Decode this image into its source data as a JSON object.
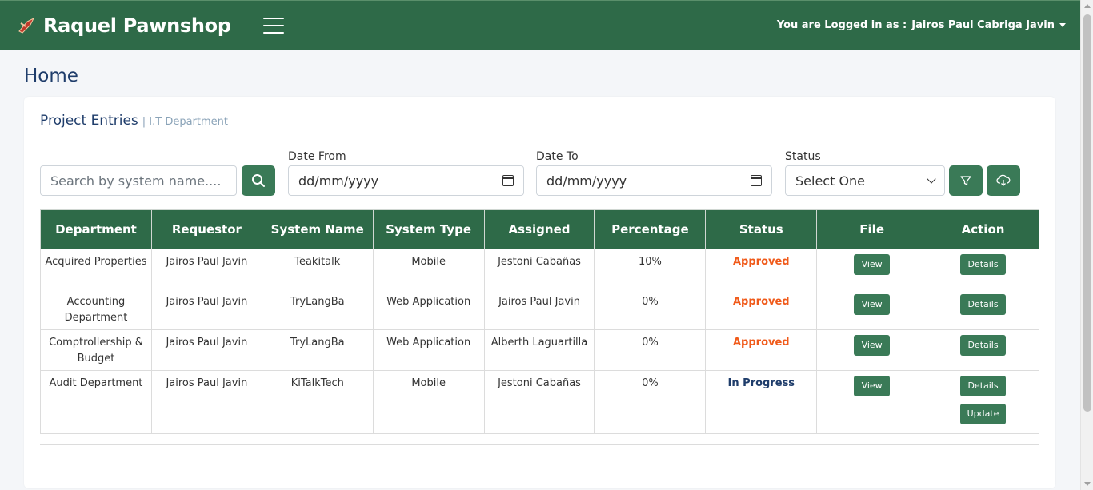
{
  "app": {
    "brand_name": "Raquel Pawnshop",
    "user_prefix": "You are Logged in as :",
    "user_name": "Jairos Paul Cabriga Javin",
    "accent_color": "#2e6a48"
  },
  "page": {
    "title": "Home"
  },
  "card": {
    "title": "Project Entries",
    "subtitle": "| I.T Department"
  },
  "filters": {
    "search_placeholder": "Search by system name....",
    "date_from_label": "Date From",
    "date_from_value": "dd/mm/yyyy",
    "date_to_label": "Date To",
    "date_to_value": "dd/mm/yyyy",
    "status_label": "Status",
    "status_value": "Select One"
  },
  "table": {
    "headers": [
      "Department",
      "Requestor",
      "System Name",
      "System Type",
      "Assigned",
      "Percentage",
      "Status",
      "File",
      "Action"
    ],
    "rows": [
      {
        "department": "Acquired Properties",
        "requestor": "Jairos Paul Javin",
        "system_name": "Teakitalk",
        "system_type": "Mobile",
        "assigned": "Jestoni Cabañas",
        "percentage": "10%",
        "status": "Approved",
        "file": "View",
        "actions": [
          "Details"
        ]
      },
      {
        "department": "Accounting Department",
        "requestor": "Jairos Paul Javin",
        "system_name": "TryLangBa",
        "system_type": "Web Application",
        "assigned": "Jairos Paul Javin",
        "percentage": "0%",
        "status": "Approved",
        "file": "View",
        "actions": [
          "Details"
        ]
      },
      {
        "department": "Comptrollership & Budget",
        "requestor": "Jairos Paul Javin",
        "system_name": "TryLangBa",
        "system_type": "Web Application",
        "assigned": "Alberth Laguartilla",
        "percentage": "0%",
        "status": "Approved",
        "file": "View",
        "actions": [
          "Details"
        ]
      },
      {
        "department": "Audit Department",
        "requestor": "Jairos Paul Javin",
        "system_name": "KiTalkTech",
        "system_type": "Mobile",
        "assigned": "Jestoni Cabañas",
        "percentage": "0%",
        "status": "In Progress",
        "file": "View",
        "actions": [
          "Details",
          "Update"
        ]
      }
    ]
  }
}
